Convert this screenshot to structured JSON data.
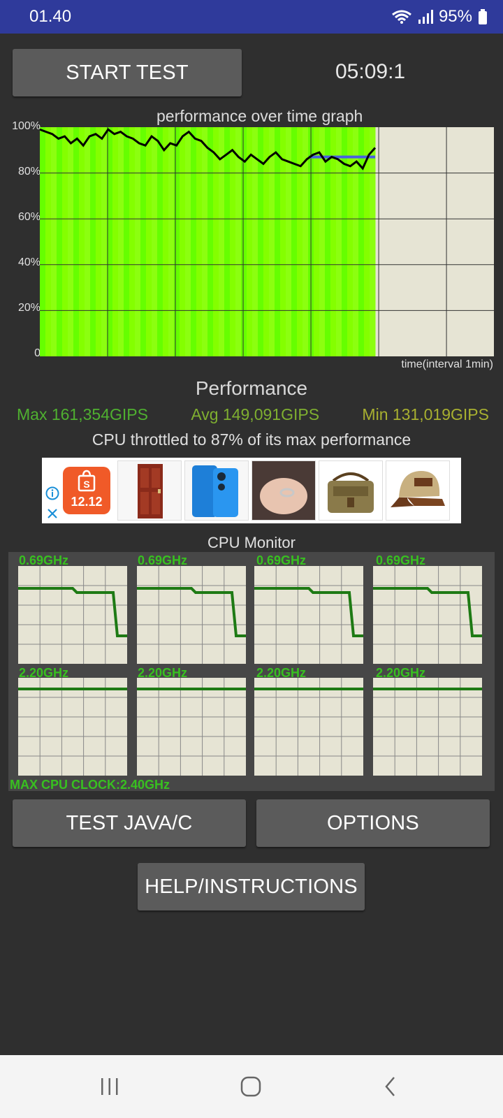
{
  "status_bar": {
    "time": "01.40",
    "battery": "95%",
    "icons": [
      "wifi-icon",
      "signal-icon",
      "battery-icon"
    ]
  },
  "controls": {
    "start_test": "START TEST",
    "timer": "05:09:1",
    "test_java_c": "TEST JAVA/C",
    "options": "OPTIONS",
    "help": "HELP/INSTRUCTIONS"
  },
  "graph": {
    "title": "performance over time graph",
    "y_ticks": [
      "100%",
      "80%",
      "60%",
      "40%",
      "20%",
      "0"
    ],
    "x_label": "time(interval 1min)"
  },
  "performance": {
    "title": "Performance",
    "max": "Max 161,354GIPS",
    "avg": "Avg 149,091GIPS",
    "min": "Min 131,019GIPS",
    "throttle": "CPU throttled to 87% of its max performance",
    "colors": {
      "max": "#4fb030",
      "avg": "#7faf30",
      "min": "#a8b030"
    }
  },
  "ad": {
    "badge": "12.12",
    "icons": [
      "info-icon",
      "close-icon",
      "shop-bag-icon"
    ]
  },
  "cpu_monitor": {
    "title": "CPU Monitor",
    "cores_top": [
      "0.69GHz",
      "0.69GHz",
      "0.69GHz",
      "0.69GHz"
    ],
    "cores_bottom": [
      "2.20GHz",
      "2.20GHz",
      "2.20GHz",
      "2.20GHz"
    ],
    "max_clock": "MAX CPU CLOCK:2.40GHz"
  },
  "chart_data": {
    "type": "area",
    "title": "performance over time graph",
    "xlabel": "time(interval 1min)",
    "ylabel": "",
    "ylim": [
      0,
      100
    ],
    "y_ticks": [
      "100%",
      "80%",
      "60%",
      "40%",
      "20%",
      "0"
    ],
    "series": [
      {
        "values": [
          99,
          98,
          97,
          95,
          96,
          93,
          95,
          92,
          96,
          97,
          95,
          99,
          97,
          98,
          96,
          95,
          93,
          92,
          96,
          94,
          90,
          93,
          92,
          96,
          98,
          95,
          94,
          91,
          89,
          86,
          88,
          90,
          87,
          85,
          88,
          86,
          84,
          87,
          89,
          86,
          85,
          84,
          83,
          86,
          88,
          89,
          85,
          87,
          86,
          84,
          83,
          85,
          82,
          88,
          91
        ]
      }
    ],
    "avg_line": 87
  }
}
